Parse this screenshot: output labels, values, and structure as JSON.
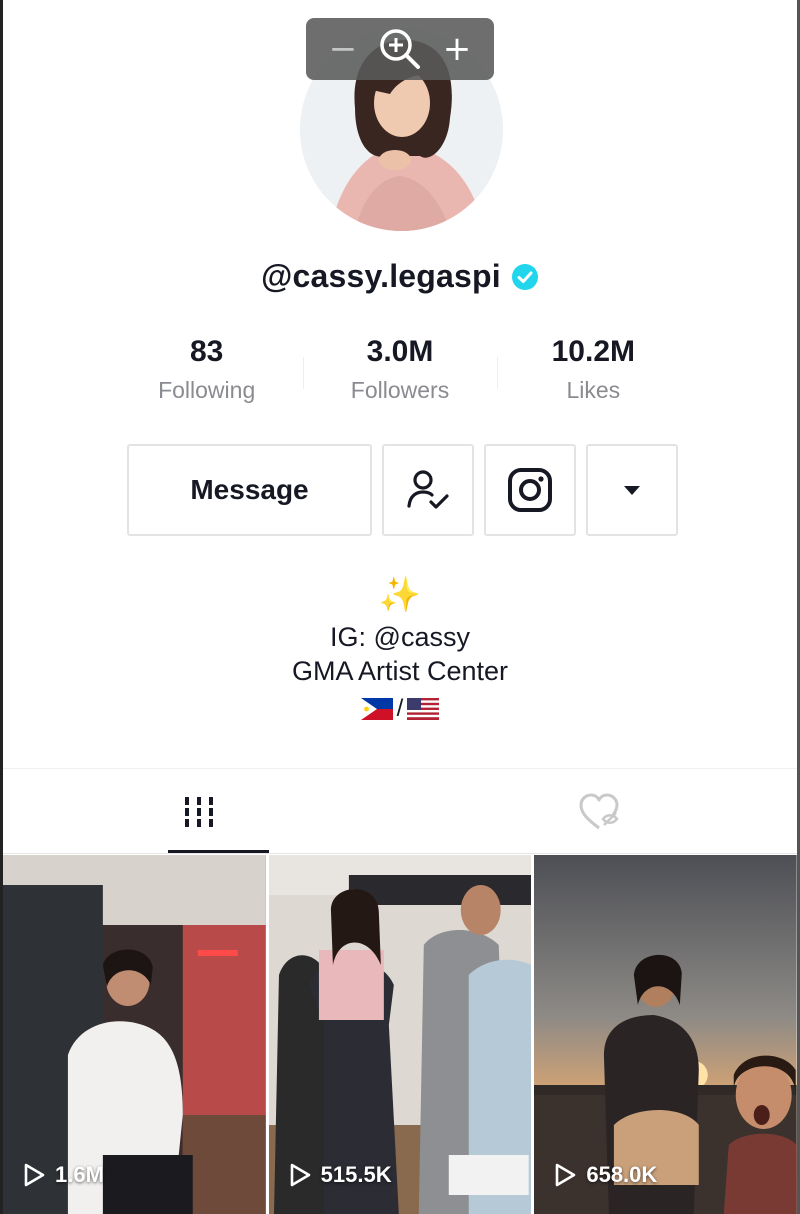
{
  "profile": {
    "username": "@cassy.legaspi",
    "verified": true,
    "avatar_icon": "profile-photo"
  },
  "zoom_control": {
    "minus": "−",
    "plus": "+",
    "icon": "zoom-in-icon"
  },
  "stats": [
    {
      "value": "83",
      "label": "Following"
    },
    {
      "value": "3.0M",
      "label": "Followers"
    },
    {
      "value": "10.2M",
      "label": "Likes"
    }
  ],
  "actions": {
    "message_label": "Message",
    "friends_icon": "user-check-icon",
    "instagram_icon": "instagram-icon",
    "more_icon": "caret-down-icon"
  },
  "bio": {
    "sparkles": "✨",
    "line1": "IG: @cassy",
    "line2": "GMA Artist Center",
    "flags_separator": "/"
  },
  "tabs": [
    {
      "icon": "videos-grid-icon",
      "active": true
    },
    {
      "icon": "liked-hidden-icon",
      "active": false
    }
  ],
  "videos": [
    {
      "views": "1.6M"
    },
    {
      "views": "515.5K"
    },
    {
      "views": "658.0K"
    }
  ],
  "colors": {
    "verified_blue": "#20d5ec",
    "text": "#161823",
    "muted": "#8a8b91"
  }
}
